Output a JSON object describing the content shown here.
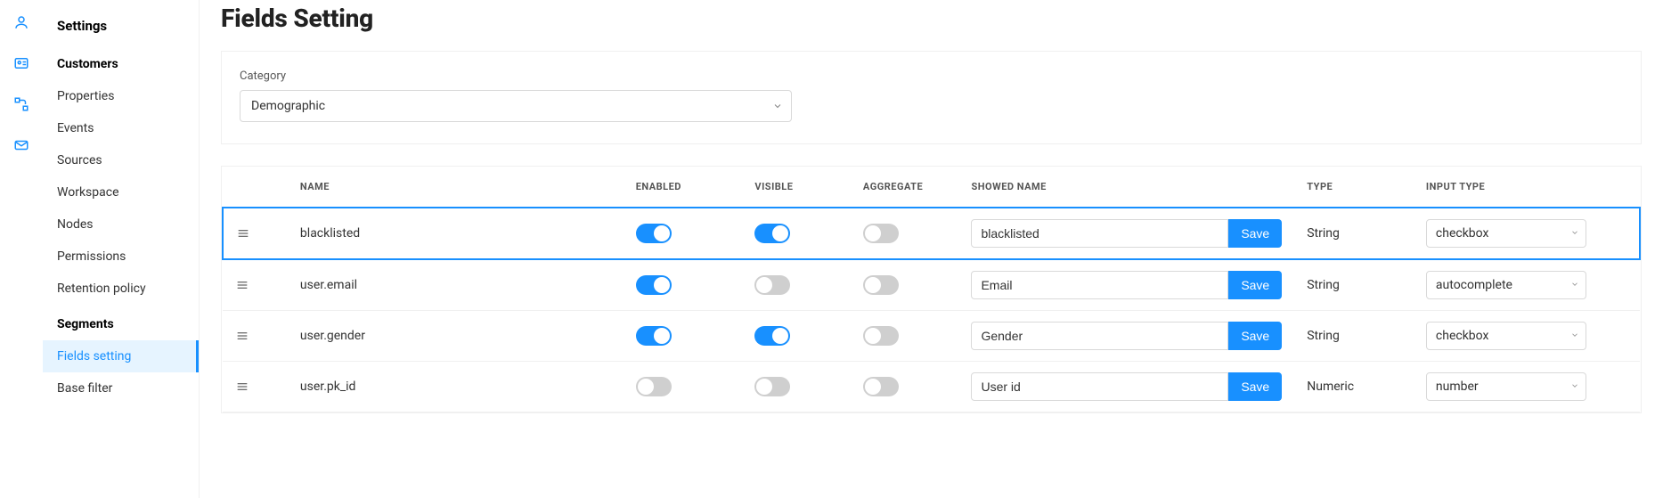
{
  "sidebar": {
    "heading": "Settings",
    "groups": [
      {
        "title": "Customers",
        "items": [
          {
            "label": "Properties",
            "active": false
          },
          {
            "label": "Events",
            "active": false
          },
          {
            "label": "Sources",
            "active": false
          },
          {
            "label": "Workspace",
            "active": false
          },
          {
            "label": "Nodes",
            "active": false
          },
          {
            "label": "Permissions",
            "active": false
          },
          {
            "label": "Retention policy",
            "active": false
          }
        ]
      },
      {
        "title": "Segments",
        "items": [
          {
            "label": "Fields setting",
            "active": true
          },
          {
            "label": "Base filter",
            "active": false
          }
        ]
      }
    ]
  },
  "page": {
    "title": "Fields Setting",
    "category_label": "Category",
    "category_value": "Demographic"
  },
  "table": {
    "headers": {
      "name": "NAME",
      "enabled": "ENABLED",
      "visible": "VISIBLE",
      "aggregate": "AGGREGATE",
      "showed_name": "SHOWED NAME",
      "type": "TYPE",
      "input_type": "INPUT TYPE"
    },
    "save_label": "Save",
    "rows": [
      {
        "name": "blacklisted",
        "enabled": true,
        "visible": true,
        "aggregate": false,
        "showed_name": "blacklisted",
        "type": "String",
        "input_type": "checkbox",
        "selected": true
      },
      {
        "name": "user.email",
        "enabled": true,
        "visible": false,
        "aggregate": false,
        "showed_name": "Email",
        "type": "String",
        "input_type": "autocomplete",
        "selected": false
      },
      {
        "name": "user.gender",
        "enabled": true,
        "visible": true,
        "aggregate": false,
        "showed_name": "Gender",
        "type": "String",
        "input_type": "checkbox",
        "selected": false
      },
      {
        "name": "user.pk_id",
        "enabled": false,
        "visible": false,
        "aggregate": false,
        "showed_name": "User id",
        "type": "Numeric",
        "input_type": "number",
        "selected": false
      }
    ]
  }
}
